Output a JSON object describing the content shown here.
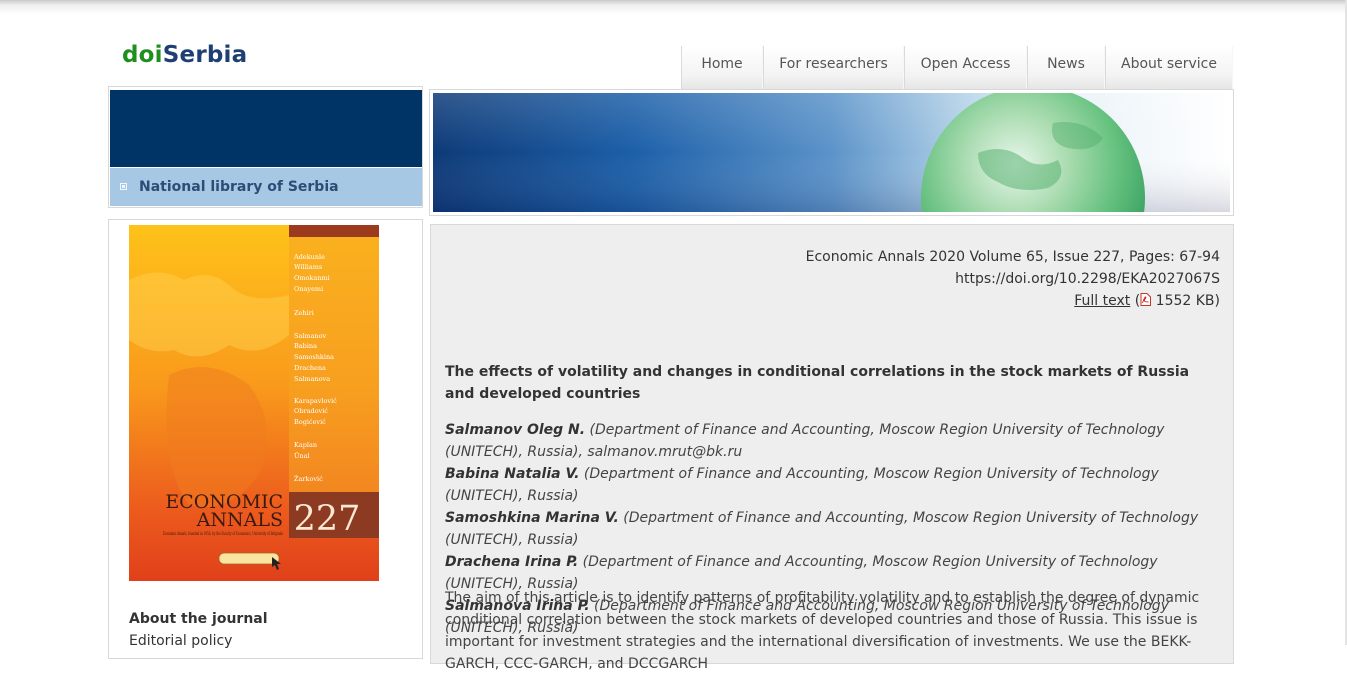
{
  "logo": {
    "doi": "doi",
    "serbia": "Serbia"
  },
  "nav": [
    "Home",
    "For researchers",
    "Open Access",
    "News",
    "About service"
  ],
  "sidebar": {
    "library_link": "National library of Serbia",
    "about_title": "About the journal",
    "editorial_link": "Editorial policy"
  },
  "cover": {
    "title_line1": "ECONOMIC",
    "title_line2": "ANNALS",
    "issue_number": "227",
    "subtitle": "Economic Annals, founded in 1956, by the Faculty of Economics, University of Belgrade",
    "authors": [
      "Adekunle",
      "Williams",
      "Omokanmi",
      "Onayemi",
      "Zehiri",
      "Salmanov",
      "Babina",
      "Samoshkina",
      "Drachena",
      "Salmanova",
      "Karapavlović",
      "Obradović",
      "Bogićević",
      "Kaplan",
      "Ünal",
      "Žarković"
    ]
  },
  "article": {
    "citation": "Economic Annals 2020 Volume 65, Issue 227, Pages: 67-94",
    "doi": "https://doi.org/10.2298/EKA2027067S",
    "full_text_label": "Full text",
    "file_size": "1552 KB",
    "title": "The effects of volatility and changes in conditional correlations in the stock markets of Russia and developed countries",
    "authors": [
      {
        "name": "Salmanov Oleg N.",
        "affiliation": "(Department of Finance and Accounting, Moscow Region University of Technology (UNITECH), Russia), salmanov.mrut@bk.ru"
      },
      {
        "name": "Babina Natalia V.",
        "affiliation": "(Department of Finance and Accounting, Moscow Region University of Technology (UNITECH), Russia)"
      },
      {
        "name": "Samoshkina Marina V.",
        "affiliation": "(Department of Finance and Accounting, Moscow Region University of Technology (UNITECH), Russia)"
      },
      {
        "name": "Drachena Irina P.",
        "affiliation": "(Department of Finance and Accounting, Moscow Region University of Technology (UNITECH), Russia)"
      },
      {
        "name": "Salmanova Irina P.",
        "affiliation": "(Department of Finance and Accounting, Moscow Region University of Technology (UNITECH), Russia)"
      }
    ],
    "abstract": "The aim of this article is to identify patterns of profitability volatility and to establish the degree of dynamic conditional correlation between the stock markets of developed countries and those of Russia. This issue is important for investment strategies and the international diversification of investments. We use the BEKK-GARCH, CCC-GARCH, and DCCGARCH"
  },
  "colors": {
    "navy": "#003366",
    "light_blue": "#a6c8e4",
    "logo_green": "#1f8f1f",
    "logo_blue": "#1e3f73",
    "content_bg": "#eeeeee"
  }
}
